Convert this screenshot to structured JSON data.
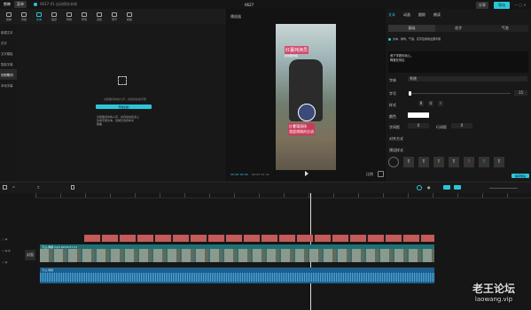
{
  "title_bar": {
    "app_name": "剪映",
    "menu_label": "菜单",
    "doc_name": "0627-01 自动保存本地",
    "window_title": "0627",
    "share_label": "分享",
    "export_label": "导出"
  },
  "toolbar": {
    "items": [
      "媒体",
      "音频",
      "文本",
      "贴纸",
      "特效",
      "转场",
      "滤镜",
      "调节",
      "模板"
    ]
  },
  "left_nav": {
    "items": [
      "新建文本",
      "花字",
      "文字模板",
      "智能字幕",
      "识别歌词",
      "本地字幕"
    ],
    "active_index": 4
  },
  "left_panel": {
    "hint": "识别歌词中的人声，并自动生成字幕",
    "button_label": "开始识别",
    "desc_lines": [
      "识别歌词中的人声，并自动在轨道上",
      "生成字幕文本，目前仅支持中文",
      "歌曲"
    ]
  },
  "player": {
    "title": "播放器",
    "time_current": "00:00:00:00",
    "time_total": "00:02:07:21",
    "overlay_title": "红薯炖演员",
    "overlay_sub": "我想要你跳",
    "overlay_bottom": [
      "红薯蒲演扬",
      "我超想跳的交流"
    ],
    "ratio_label": "比例",
    "fullscreen_icon": "fullscreen-icon"
  },
  "inspector": {
    "tabs": [
      "文本",
      "动画",
      "跟踪",
      "朗读"
    ],
    "subtabs": [
      "基础",
      "花字",
      "气泡"
    ],
    "checkbox_label": "文本、排列、气泡、花字应用到全部字幕",
    "text_value": "而下学着你玩儿，\n降落在你边",
    "font_label": "字体",
    "font_value": "系统",
    "size_label": "字号",
    "size_value": "15",
    "style_label": "样式",
    "color_label": "颜色",
    "spacing_label": "字间距",
    "spacing_value": "0",
    "line_label": "行间距",
    "line_value": "0",
    "align_label": "对齐方式",
    "preset_label": "预设样式",
    "save_label": "保存预设"
  },
  "timeline": {
    "track_label": "封面",
    "clip1_name": "不山-弹歌.mp4 00:02:07:21",
    "audio_name": "不山-弹歌"
  },
  "watermark": {
    "line1": "老王论坛",
    "line2": "laowang.vip"
  },
  "colors": {
    "accent": "#2bc6d9",
    "clip_video": "#1f6f73",
    "clip_text": "#c45a5a",
    "clip_audio": "#1b5f8c"
  }
}
